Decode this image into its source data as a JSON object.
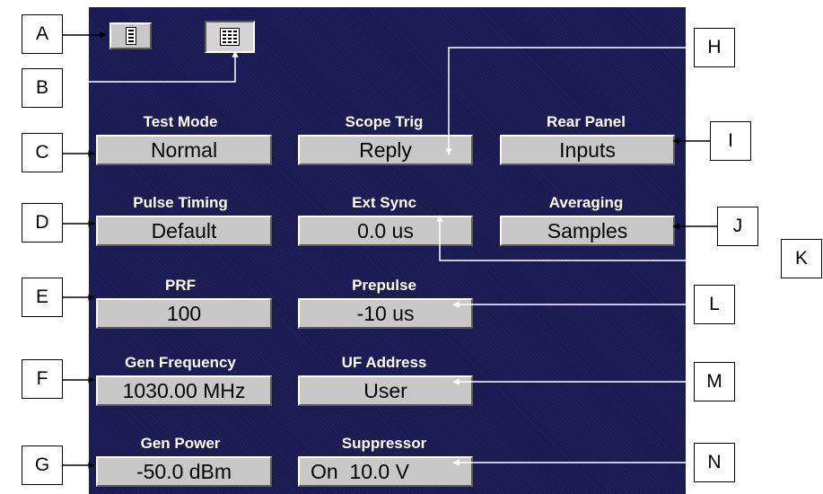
{
  "callouts": {
    "a": "A",
    "b": "B",
    "c": "C",
    "d": "D",
    "e": "E",
    "f": "F",
    "g": "G",
    "h": "H",
    "i": "I",
    "j": "J",
    "k": "K",
    "l": "L",
    "m": "M",
    "n": "N"
  },
  "fields": {
    "test_mode": {
      "label": "Test Mode",
      "value": "Normal"
    },
    "scope_trig": {
      "label": "Scope Trig",
      "value": "Reply"
    },
    "rear_panel": {
      "label": "Rear Panel",
      "value": "Inputs"
    },
    "pulse_timing": {
      "label": "Pulse Timing",
      "value": "Default"
    },
    "ext_sync": {
      "label": "Ext Sync",
      "value": "0.0 us"
    },
    "averaging": {
      "label": "Averaging",
      "value": "Samples"
    },
    "prf": {
      "label": "PRF",
      "value": "100"
    },
    "prepulse": {
      "label": "Prepulse",
      "value": "-10 us"
    },
    "gen_frequency": {
      "label": "Gen Frequency",
      "value": "1030.00 MHz"
    },
    "uf_address": {
      "label": "UF Address",
      "value": "User"
    },
    "gen_power": {
      "label": "Gen Power",
      "value": "-50.0 dBm"
    },
    "suppressor": {
      "label": "Suppressor",
      "value": "On  10.0 V"
    }
  },
  "icons": {
    "single_column_view": "single-column-icon",
    "grid_view": "grid-icon"
  },
  "colors": {
    "panel_background": "#1a1a52",
    "button_face": "#c8c8c8",
    "label_text": "#ffffff"
  }
}
